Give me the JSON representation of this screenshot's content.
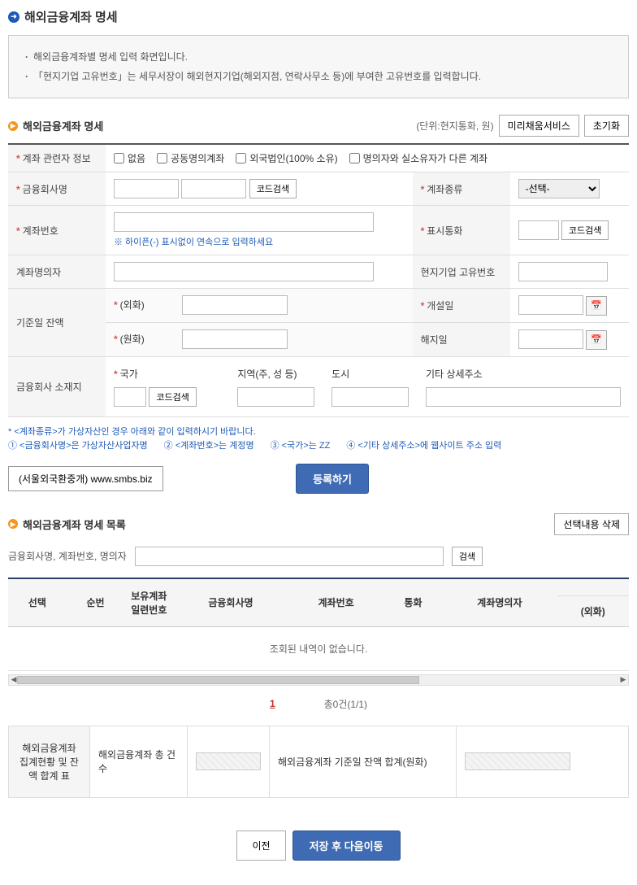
{
  "page": {
    "title": "해외금융계좌 명세"
  },
  "info": {
    "line1": "해외금융계좌별 명세 입력 화면입니다.",
    "line2": "「현지기업 고유번호」는 세무서장이 해외현지기업(해외지점, 연락사무소 등)에 부여한 고유번호를 입력합니다."
  },
  "section_detail": {
    "title": "해외금융계좌 명세",
    "unit": "(단위:현지통화, 원)",
    "btn_prefill": "미리채움서비스",
    "btn_reset": "초기화"
  },
  "form": {
    "related_label": "계좌 관련자 정보",
    "chk_none": "없음",
    "chk_joint": "공동명의계좌",
    "chk_foreign": "외국법인(100% 소유)",
    "chk_diff": "명의자와 실소유자가 다른 계좌",
    "company_label": "금융회사명",
    "code_search": "코드검색",
    "account_type_label": "계좌종류",
    "account_type_placeholder": "-선택-",
    "account_no_label": "계좌번호",
    "account_no_hint": "※ 하이픈(-) 표시없이 연속으로 입력하세요",
    "currency_label": "표시통화",
    "holder_label": "계좌명의자",
    "local_no_label": "현지기업 고유번호",
    "balance_label": "기준일 잔액",
    "balance_fc": "(외화)",
    "balance_krw": "(원화)",
    "open_date_label": "개설일",
    "close_date_label": "해지일",
    "addr_label": "금융회사 소재지",
    "country": "국가",
    "region": "지역(주, 성 등)",
    "city": "도시",
    "addr_etc": "기타 상세주소"
  },
  "notes": {
    "title": "* <계좌종류>가 가상자산인 경우 아래와 같이 입력하시기 바랍니다.",
    "n1": "① <금융회사명>은 가상자산사업자명",
    "n2": "② <계좌번호>는 계정명",
    "n3": "③ <국가>는  ZZ",
    "n4": "④ <기타 상세주소>에 웹사이트 주소 입력"
  },
  "link_button": "(서울외국환중개) www.smbs.biz",
  "btn_register": "등록하기",
  "section_list": {
    "title": "해외금융계좌 명세 목록",
    "btn_delete": "선택내용 삭제",
    "search_label": "금융회사명, 계좌번호, 명의자",
    "btn_search": "검색",
    "cols": {
      "select": "선택",
      "seq": "순번",
      "hold_seq": "보유계좌일련번호",
      "company": "금융회사명",
      "account_no": "계좌번호",
      "currency": "통화",
      "holder": "계좌명의자",
      "fc": "(외화)"
    },
    "empty": "조회된 내역이 없습니다.",
    "page_num": "1",
    "page_info": "총0건(1/1)"
  },
  "summary": {
    "title": "해외금융계좌 집계현황 및 잔액 합계 표",
    "count_label": "해외금융계좌 총 건수",
    "balance_label": "해외금융계좌 기준일 잔액 합계(원화)"
  },
  "bottom": {
    "prev": "이전",
    "save_next": "저장 후 다음이동"
  }
}
